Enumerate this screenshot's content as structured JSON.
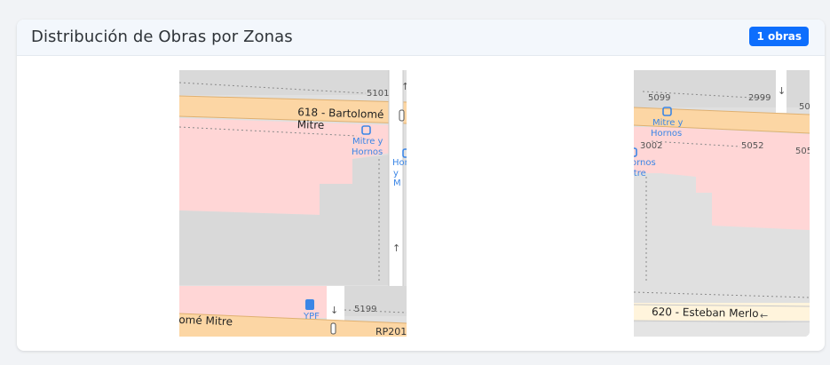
{
  "header": {
    "title": "Distribución de Obras por Zonas",
    "badge": "1 obras"
  },
  "map_left": {
    "street_main": "618 - Bartolomé Mitre",
    "street_main_partial": "lomé Mitre",
    "stop_name_1": "Mitre y",
    "stop_name_2": "Hornos",
    "stop2_partial_1": "Hor",
    "stop2_partial_2": "y M",
    "house_top": "5101",
    "house_bottom": "5199",
    "fuel_label": "YPF",
    "route": "RP201"
  },
  "map_right": {
    "house_1": "5099",
    "house_2": "2999",
    "house_3": "50",
    "house_4": "3002",
    "house_5": "5052",
    "house_6": "505",
    "stop_name_1": "Mitre y",
    "stop_name_2": "Hornos",
    "stop_partial_1": "ornos",
    "stop_partial_2": "itre",
    "street_bottom": "620 - Esteban Merlo"
  },
  "colors": {
    "accent": "#0d6efd",
    "road_primary": "#fcd6a4",
    "residential": "#ffd6d6",
    "building": "#d9d9d9",
    "transit_label": "#3b86e6"
  }
}
